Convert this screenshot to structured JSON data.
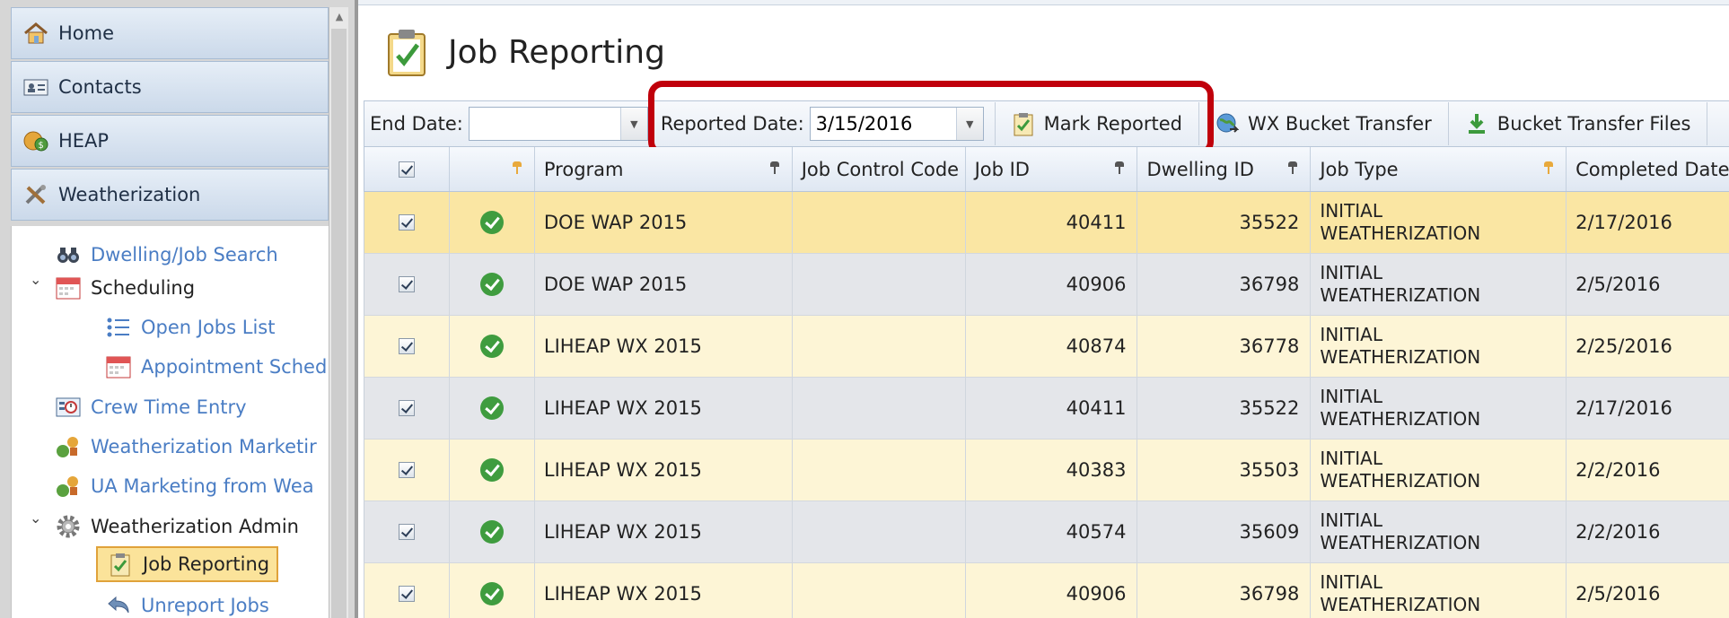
{
  "sidebar": {
    "accordion": [
      {
        "label": "Home",
        "icon": "home-icon"
      },
      {
        "label": "Contacts",
        "icon": "contact-card-icon"
      },
      {
        "label": "HEAP",
        "icon": "money-bag-icon"
      },
      {
        "label": "Weatherization",
        "icon": "tools-icon"
      }
    ],
    "tree": [
      {
        "label": "Dwelling/Job Search",
        "icon": "binoculars-icon"
      },
      {
        "label": "Scheduling",
        "icon": "calendar-icon"
      },
      {
        "label": "Open Jobs List",
        "icon": "list-icon"
      },
      {
        "label": "Appointment Sched",
        "icon": "calendar-icon"
      },
      {
        "label": "Crew Time Entry",
        "icon": "time-entry-icon"
      },
      {
        "label": "Weatherization Marketir",
        "icon": "marketing-icon"
      },
      {
        "label": "UA Marketing from Wea",
        "icon": "marketing-icon"
      },
      {
        "label": "Weatherization Admin",
        "icon": "gear-icon"
      },
      {
        "label": "Job Reporting",
        "icon": "clipboard-check-icon"
      },
      {
        "label": "Unreport Jobs",
        "icon": "undo-icon"
      }
    ]
  },
  "page": {
    "title": "Job Reporting"
  },
  "toolbar": {
    "end_date_label": "End Date:",
    "end_date_value": "",
    "reported_date_label": "Reported Date:",
    "reported_date_value": "3/15/2016",
    "mark_reported": "Mark Reported",
    "wx_bucket_transfer": "WX Bucket Transfer",
    "bucket_transfer_files": "Bucket Transfer Files"
  },
  "grid": {
    "columns": {
      "program": "Program",
      "job_control_code": "Job Control Code",
      "job_id": "Job ID",
      "dwelling_id": "Dwelling ID",
      "job_type": "Job Type",
      "completed_date": "Completed Date"
    },
    "rows": [
      {
        "program": "DOE WAP 2015",
        "job_control_code": "",
        "job_id": "40411",
        "dwelling_id": "35522",
        "job_type_1": "INITIAL",
        "job_type_2": "WEATHERIZATION",
        "completed_date": "2/17/2016"
      },
      {
        "program": "DOE WAP 2015",
        "job_control_code": "",
        "job_id": "40906",
        "dwelling_id": "36798",
        "job_type_1": "INITIAL",
        "job_type_2": "WEATHERIZATION",
        "completed_date": "2/5/2016"
      },
      {
        "program": "LIHEAP WX 2015",
        "job_control_code": "",
        "job_id": "40874",
        "dwelling_id": "36778",
        "job_type_1": "INITIAL",
        "job_type_2": "WEATHERIZATION",
        "completed_date": "2/25/2016"
      },
      {
        "program": "LIHEAP WX 2015",
        "job_control_code": "",
        "job_id": "40411",
        "dwelling_id": "35522",
        "job_type_1": "INITIAL",
        "job_type_2": "WEATHERIZATION",
        "completed_date": "2/17/2016"
      },
      {
        "program": "LIHEAP WX 2015",
        "job_control_code": "",
        "job_id": "40383",
        "dwelling_id": "35503",
        "job_type_1": "INITIAL",
        "job_type_2": "WEATHERIZATION",
        "completed_date": "2/2/2016"
      },
      {
        "program": "LIHEAP WX 2015",
        "job_control_code": "",
        "job_id": "40574",
        "dwelling_id": "35609",
        "job_type_1": "INITIAL",
        "job_type_2": "WEATHERIZATION",
        "completed_date": "2/2/2016"
      },
      {
        "program": "LIHEAP WX 2015",
        "job_control_code": "",
        "job_id": "40906",
        "dwelling_id": "36798",
        "job_type_1": "INITIAL",
        "job_type_2": "WEATHERIZATION",
        "completed_date": "2/5/2016"
      }
    ]
  },
  "colors": {
    "highlight": "#c0000b",
    "selected_row": "#fae6a3",
    "link": "#4a7dc4"
  }
}
